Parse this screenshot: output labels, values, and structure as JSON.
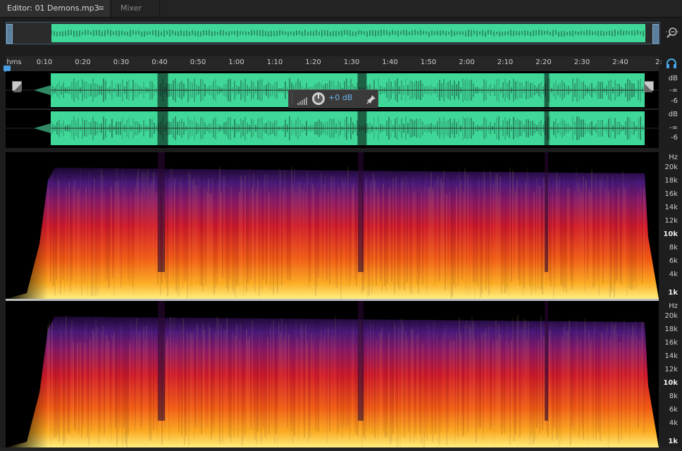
{
  "tabs": {
    "editor_label": "Editor: 01 Demons.mp3",
    "mixer_label": "Mixer",
    "menu_glyph": "≡"
  },
  "ruler": {
    "unit": "hms",
    "ticks": [
      "0:10",
      "0:20",
      "0:30",
      "0:40",
      "0:50",
      "1:00",
      "1:10",
      "1:20",
      "1:30",
      "1:40",
      "1:50",
      "2:00",
      "2:10",
      "2:20",
      "2:30",
      "2:40",
      "2:"
    ]
  },
  "waveform": {
    "db_labels": [
      "dB",
      "-∞",
      "-6",
      "dB",
      "-∞",
      "-6"
    ],
    "color": "#3fd898"
  },
  "volume_hud": {
    "value": "+0 dB"
  },
  "spectral": {
    "hz_labels": [
      "Hz",
      "20k",
      "18k",
      "16k",
      "14k",
      "12k",
      "10k",
      "8k",
      "6k",
      "4k",
      "1k"
    ],
    "bold_labels": [
      "10k",
      "1k"
    ]
  },
  "icons": {
    "zoom": "zoom-magnifier-icon",
    "headphone": "headphone-icon",
    "pin": "pin-icon",
    "knob": "volume-knob-icon"
  },
  "colors": {
    "waveform_green": "#3fd898",
    "accent_blue": "#6fb6f0",
    "overview_border": "#3c5c73"
  }
}
